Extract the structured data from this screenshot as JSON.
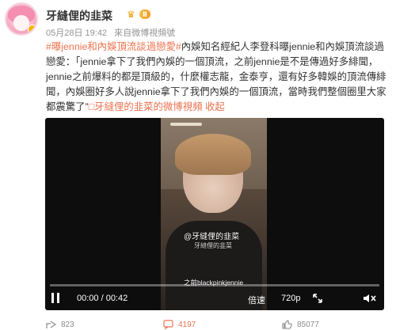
{
  "colors": {
    "accent": "#eb7350",
    "meta": "#939393",
    "vip_gold": "#f3a210"
  },
  "author": {
    "name": "牙縫俚的韭菜",
    "vip_label": "Ⅱ",
    "timestamp": "05月28日 19:42",
    "source": "來自微博視頻號"
  },
  "post": {
    "hashtag": "#曝jennie和內娛頂流談過戀愛#",
    "intro": "內娛知名經紀人李登科曝jennie和內娛頂流談過戀愛：",
    "quote": "「jennie拿下了我們內娛的一個頂流，之前jennie是不是傳過好多緋聞，jennie之前爆料的都是頂級的，什麼權志龍，金泰亨，還有好多韓娛的頂流傳緋聞，內娛圈好多人說jennie拿下了我們內娛的一個頂流，當時我們整個圈里大家都震驚了”",
    "video_link": "□牙縫俚的韭菜的微博視頻",
    "collapse": "收起"
  },
  "video": {
    "watermark_main": "@牙縫俚的韭菜",
    "watermark_sub": "牙縫俚的韭菜",
    "subtitle": "之前blackpinkjennie",
    "time": "00:00 / 00:42",
    "progress_fraction": 0.0,
    "quality": "倍速",
    "resolution": "720p",
    "icons": [
      "pause-icon",
      "pip-icon",
      "mute-icon"
    ]
  },
  "actions": {
    "share_count": "823",
    "comment_count": "4197",
    "like_count": "85077"
  }
}
